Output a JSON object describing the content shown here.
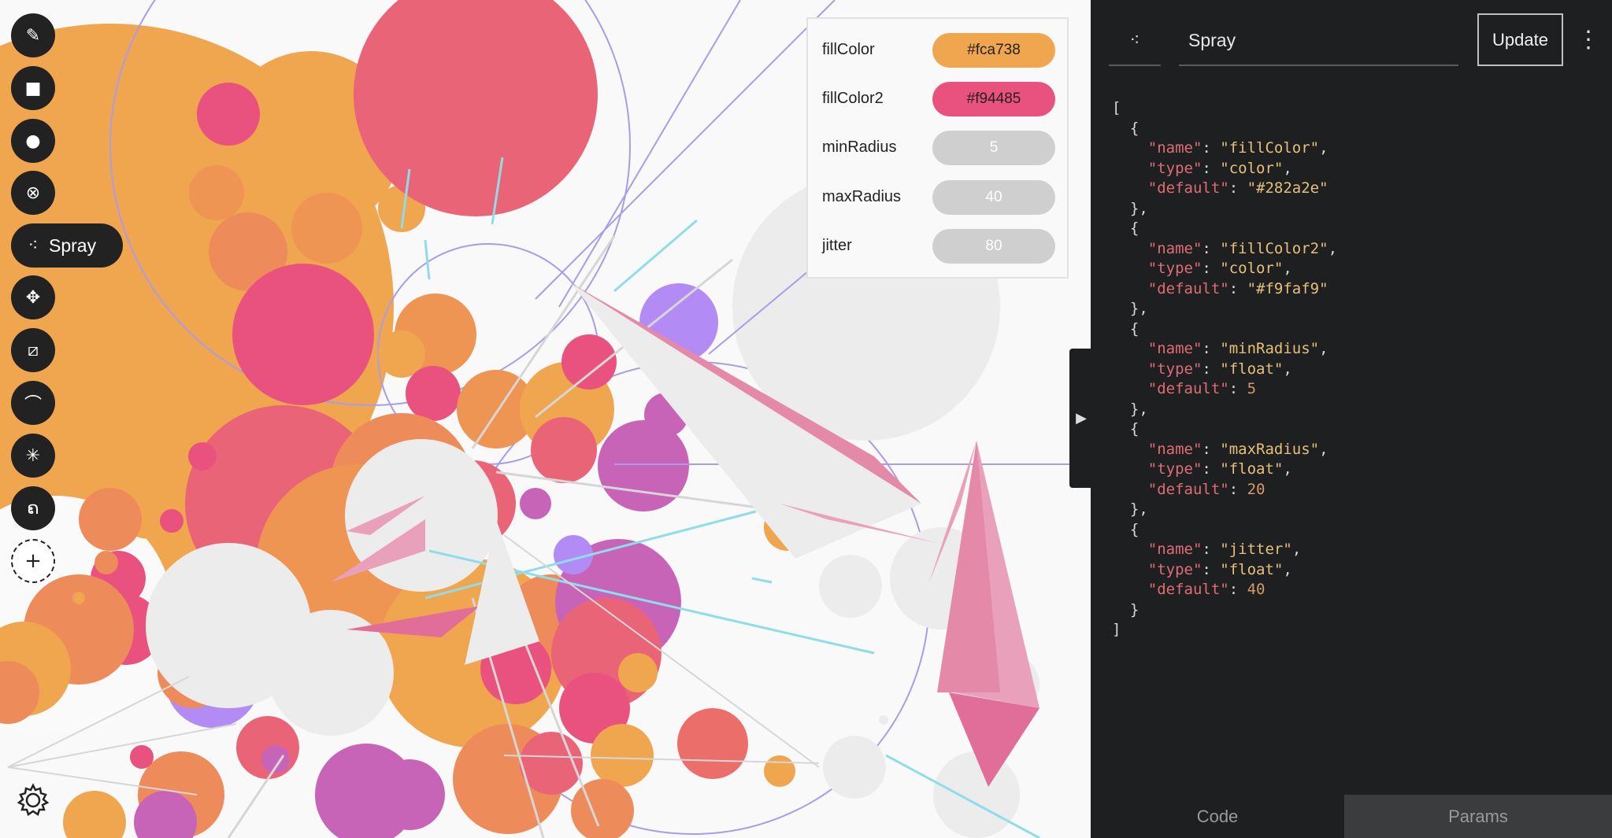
{
  "toolbar": {
    "tools": [
      {
        "name": "pencil-icon",
        "glyph": "✎"
      },
      {
        "name": "square-icon",
        "glyph": "■"
      },
      {
        "name": "circle-icon",
        "glyph": "●"
      },
      {
        "name": "link-icon",
        "glyph": "⊗"
      },
      {
        "name": "spray-icon",
        "glyph": "⁖",
        "label": "Spray"
      },
      {
        "name": "move-icon",
        "glyph": "✥"
      },
      {
        "name": "slash-box-icon",
        "glyph": "⧄"
      },
      {
        "name": "arc-icon",
        "glyph": "⌒"
      },
      {
        "name": "asterisk-icon",
        "glyph": "✳"
      },
      {
        "name": "script-icon",
        "glyph": "ຄ"
      },
      {
        "name": "add-tool-icon",
        "glyph": "+"
      }
    ],
    "settings_icon": "gear-icon"
  },
  "params": [
    {
      "label": "fillColor",
      "value": "#fca738",
      "color": "#f0a54f"
    },
    {
      "label": "fillColor2",
      "value": "#f94485",
      "color": "#e9527e"
    },
    {
      "label": "minRadius",
      "value": "5"
    },
    {
      "label": "maxRadius",
      "value": "40"
    },
    {
      "label": "jitter",
      "value": "80"
    }
  ],
  "editor": {
    "tool_icon": "⁖",
    "tool_name": "Spray",
    "update_label": "Update",
    "more_icon": "⋮",
    "collapse_icon": "▶",
    "code_params": [
      {
        "name": "fillColor",
        "type": "color",
        "default": "\"#282a2e\""
      },
      {
        "name": "fillColor2",
        "type": "color",
        "default": "\"#f9faf9\""
      },
      {
        "name": "minRadius",
        "type": "float",
        "default": "5"
      },
      {
        "name": "maxRadius",
        "type": "float",
        "default": "20"
      },
      {
        "name": "jitter",
        "type": "float",
        "default": "40"
      }
    ],
    "tabs": {
      "code": "Code",
      "params": "Params"
    }
  },
  "colors": {
    "orange": "#f0a54f",
    "pink": "#e9527e",
    "salmon": "#ec6e6a",
    "purple": "#b38bf5",
    "magenta": "#c864b8",
    "grey": "#ececec",
    "cyan": "#8fdcea"
  }
}
